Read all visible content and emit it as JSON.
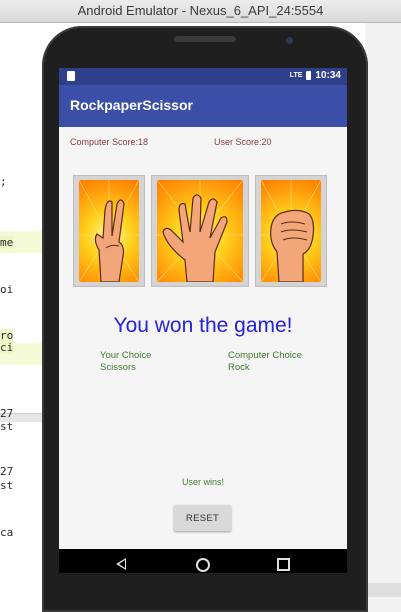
{
  "window": {
    "title": "Android Emulator - Nexus_6_API_24:5554"
  },
  "ide_fragments": [
    ";",
    "me",
    "oi",
    "ro",
    "ci",
    "27",
    "st",
    "27",
    "st",
    "ca"
  ],
  "status_bar": {
    "time": "10:34",
    "network": "LTE"
  },
  "app_bar": {
    "title": "RockpaperScissor"
  },
  "scores": {
    "computer": "Computer Score:18",
    "user": "User Score:20"
  },
  "images": [
    {
      "name": "scissors",
      "icon": "scissors-hand-icon"
    },
    {
      "name": "paper",
      "icon": "paper-hand-icon"
    },
    {
      "name": "rock",
      "icon": "rock-fist-icon"
    }
  ],
  "result_text": "You won the game!",
  "user_choice": {
    "label": "Your Choice",
    "value": "Scissors"
  },
  "computer_choice": {
    "label": "Computer Choice",
    "value": "Rock"
  },
  "winner_text": "User wins!",
  "reset_button": {
    "label": "RESET"
  },
  "nav": {
    "back": "back-icon",
    "home": "home-icon",
    "recents": "recents-icon"
  },
  "colors": {
    "app_bar": "#3b4fa8",
    "status_bar": "#2f3f8a",
    "result": "#2323d8",
    "score": "#8b3a3a",
    "choice": "#3d7a2f"
  }
}
